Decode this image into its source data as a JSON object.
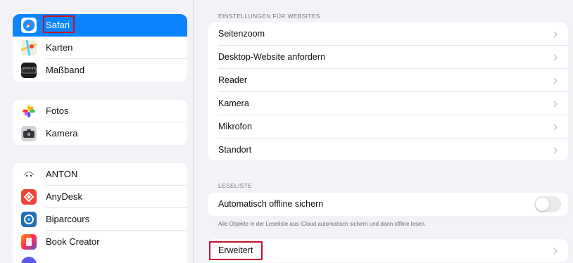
{
  "sidebar": {
    "group1": [
      {
        "label": "Safari",
        "icon": "safari-icon",
        "selected": true
      },
      {
        "label": "Karten",
        "icon": "maps-icon"
      },
      {
        "label": "Maßband",
        "icon": "measure-icon"
      }
    ],
    "group2": [
      {
        "label": "Fotos",
        "icon": "photos-icon"
      },
      {
        "label": "Kamera",
        "icon": "camera-icon"
      }
    ],
    "group3": [
      {
        "label": "ANTON",
        "icon": "anton-icon"
      },
      {
        "label": "AnyDesk",
        "icon": "anydesk-icon"
      },
      {
        "label": "Biparcours",
        "icon": "biparcours-icon"
      },
      {
        "label": "Book Creator",
        "icon": "book-creator-icon"
      }
    ]
  },
  "main": {
    "websites_header": "EINSTELLUNGEN FÜR WEBSITES",
    "website_rows": [
      "Seitenzoom",
      "Desktop-Website anfordern",
      "Reader",
      "Kamera",
      "Mikrofon",
      "Standort"
    ],
    "readinglist_header": "LESELISTE",
    "offline_label": "Automatisch offline sichern",
    "offline_toggle": false,
    "offline_footnote": "Alle Objekte in der Leseliste aus iCloud automatisch sichern und dann offline lesen.",
    "advanced_label": "Erweitert"
  },
  "colors": {
    "accent": "#0a84ff",
    "highlight": "#c8102e",
    "background": "#f2f2f7"
  }
}
